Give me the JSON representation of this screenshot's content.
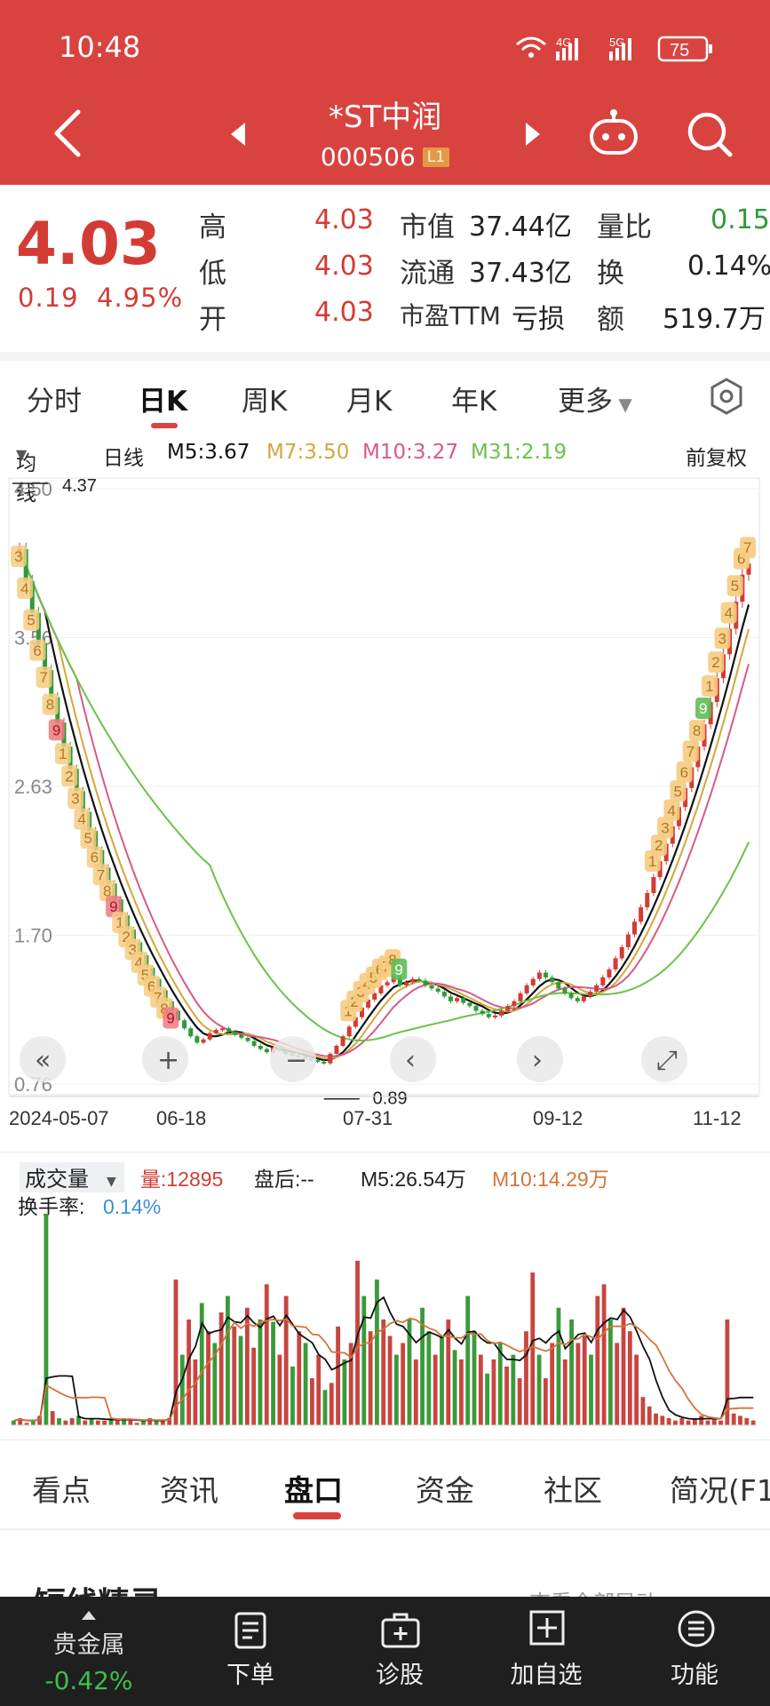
{
  "status": {
    "time": "10:48",
    "network1": "4G",
    "network2": "5G",
    "battery": "75"
  },
  "stock": {
    "name": "*ST中润",
    "code": "000506",
    "level": "L1"
  },
  "quote": {
    "price": "4.03",
    "change": "0.19",
    "change_pct": "4.95%",
    "high_label": "高",
    "high": "4.03",
    "low_label": "低",
    "low": "4.03",
    "open_label": "开",
    "open": "4.03",
    "mktcap_label": "市值",
    "mktcap": "37.44亿",
    "float_label": "流通",
    "float": "37.43亿",
    "pe_label": "市盈TTM",
    "pe": "亏损",
    "volratio_label": "量比",
    "volratio": "0.15",
    "turnover_label": "换",
    "turnover": "0.14%",
    "amount_label": "额",
    "amount": "519.7万"
  },
  "chart_tabs": [
    "分时",
    "日K",
    "周K",
    "月K",
    "年K",
    "更多"
  ],
  "ma_bar": {
    "selector": "均线",
    "period": "日线",
    "m5": "M5:3.67",
    "m7": "M7:3.50",
    "m10": "M10:3.27",
    "m31": "M31:2.19",
    "adjust": "前复权"
  },
  "colors": {
    "header": "#d9433f",
    "up": "#d23c35",
    "down": "#2e9b36",
    "m5": "#111111",
    "m7": "#d4a73a",
    "m10": "#d65a8a",
    "m31": "#6cc24a"
  },
  "chart_data": [
    {
      "type": "candlestick",
      "y_ticks": [
        "4.50",
        "3.56",
        "2.63",
        "1.70",
        "0.76"
      ],
      "x_ticks": [
        "2024-05-07",
        "06-18",
        "07-31",
        "09-12",
        "11-12"
      ],
      "ylim": [
        0.76,
        4.5
      ],
      "annotations": {
        "max": "4.37",
        "min": "0.89"
      },
      "close": [
        4.12,
        3.92,
        3.72,
        3.53,
        3.36,
        3.19,
        3.03,
        2.88,
        2.74,
        2.6,
        2.47,
        2.35,
        2.23,
        2.12,
        2.02,
        1.92,
        1.82,
        1.73,
        1.65,
        1.57,
        1.49,
        1.42,
        1.35,
        1.28,
        1.22,
        1.16,
        1.11,
        1.06,
        1.02,
        1.04,
        1.08,
        1.1,
        1.11,
        1.09,
        1.07,
        1.05,
        1.03,
        1.0,
        0.98,
        0.96,
        0.99,
        0.97,
        0.95,
        0.94,
        0.93,
        0.92,
        0.91,
        0.9,
        0.89,
        0.95,
        1.0,
        1.06,
        1.12,
        1.18,
        1.24,
        1.29,
        1.33,
        1.38,
        1.4,
        1.44,
        1.38,
        1.4,
        1.42,
        1.41,
        1.38,
        1.36,
        1.34,
        1.31,
        1.28,
        1.3,
        1.27,
        1.25,
        1.22,
        1.2,
        1.18,
        1.19,
        1.22,
        1.25,
        1.28,
        1.33,
        1.38,
        1.42,
        1.46,
        1.43,
        1.4,
        1.36,
        1.33,
        1.3,
        1.28,
        1.31,
        1.34,
        1.38,
        1.43,
        1.48,
        1.55,
        1.62,
        1.7,
        1.78,
        1.87,
        1.96,
        2.06,
        2.16,
        2.27,
        2.38,
        2.5,
        2.62,
        2.75,
        2.88,
        3.02,
        3.16,
        3.31,
        3.46,
        3.62,
        3.79,
        3.96,
        4.03
      ],
      "ma_labels": [
        "M5",
        "M7",
        "M10",
        "M31"
      ]
    },
    {
      "type": "bar",
      "title": "成交量",
      "legend": {
        "vol": "量:12895",
        "after": "盘后:--",
        "m5": "M5:26.54万",
        "m10": "M10:14.29万",
        "turnover_label": "换手率:",
        "turnover": "0.14%"
      },
      "values": [
        2,
        3,
        1,
        2,
        4,
        90,
        6,
        3,
        2,
        3,
        4,
        2,
        3,
        2,
        2,
        3,
        2,
        3,
        2,
        1,
        2,
        3,
        2,
        2,
        3,
        62,
        30,
        45,
        28,
        52,
        40,
        35,
        48,
        55,
        42,
        38,
        50,
        33,
        45,
        60,
        44,
        30,
        55,
        25,
        40,
        35,
        20,
        30,
        15,
        18,
        42,
        28,
        35,
        70,
        55,
        40,
        62,
        45,
        38,
        30,
        35,
        45,
        28,
        50,
        40,
        30,
        38,
        45,
        32,
        28,
        55,
        40,
        30,
        22,
        28,
        35,
        25,
        30,
        20,
        40,
        65,
        30,
        20,
        35,
        50,
        28,
        45,
        35,
        38,
        30,
        55,
        60,
        45,
        35,
        50,
        40,
        30,
        12,
        8,
        5,
        4,
        3,
        2,
        3,
        2,
        3,
        4,
        2,
        3,
        2,
        45,
        5,
        4,
        3,
        2
      ],
      "up": [
        0,
        1,
        1,
        0,
        1,
        0,
        1,
        0,
        1,
        1,
        0,
        1,
        0,
        1,
        1,
        0,
        1,
        0,
        1,
        1,
        0,
        1,
        0,
        1,
        1,
        1,
        0,
        1,
        1,
        0,
        1,
        0,
        1,
        0,
        1,
        0,
        1,
        1,
        0,
        1,
        0,
        1,
        1,
        0,
        1,
        0,
        1,
        1,
        0,
        1,
        1,
        0,
        1,
        1,
        0,
        1,
        0,
        1,
        1,
        0,
        1,
        0,
        1,
        0,
        0,
        1,
        0,
        1,
        0,
        1,
        0,
        0,
        1,
        0,
        1,
        0,
        1,
        0,
        1,
        1,
        1,
        0,
        1,
        1,
        0,
        1,
        0,
        1,
        1,
        0,
        1,
        1,
        0,
        1,
        1,
        1,
        1,
        1,
        1,
        1,
        1,
        1,
        1,
        1,
        1,
        1,
        1,
        1,
        1,
        1,
        1,
        1,
        1,
        1,
        1
      ]
    }
  ],
  "bottom_tabs": [
    "看点",
    "资讯",
    "盘口",
    "资金",
    "社区",
    "简况(F1"
  ],
  "section_title": "短线精灵",
  "section_more": "查看全部异动",
  "bottom_nav": {
    "index_name": "贵金属",
    "index_change": "-0.42%",
    "order": "下单",
    "diagnose": "诊股",
    "watch": "加自选",
    "func": "功能"
  }
}
